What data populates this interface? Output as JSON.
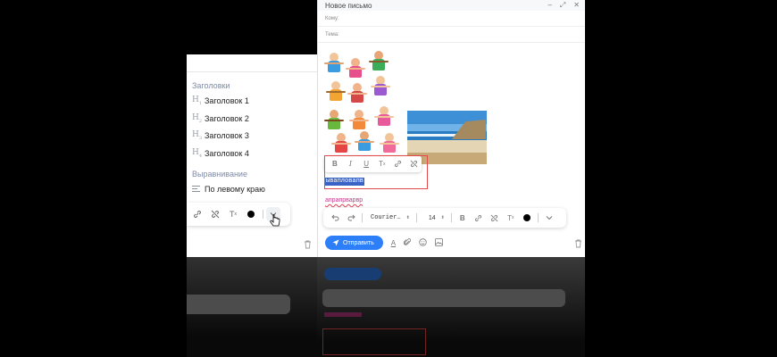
{
  "dropdown": {
    "headings_section": "Заголовки",
    "headings": [
      {
        "icon": "H",
        "level": "1",
        "label": "Заголовок 1"
      },
      {
        "icon": "H",
        "level": "2",
        "label": "Заголовок 2"
      },
      {
        "icon": "H",
        "level": "3",
        "label": "Заголовок 3"
      },
      {
        "icon": "H",
        "level": "4",
        "label": "Заголовок 4"
      }
    ],
    "align_section": "Выравнивание",
    "align_left": "По левому краю"
  },
  "compose": {
    "title": "Новое письмо",
    "to_label": "Кому:",
    "subject_label": "Тема:",
    "selected_text": "ывапловапв",
    "misspelled_text": "апрапрварвр",
    "font_name": "Courier…",
    "font_size": "14",
    "send_label": "Отправить"
  },
  "colors": {
    "accent": "#2d7ff9",
    "selection": "#3a63c8",
    "highlight_box": "#e24a4a",
    "spell_error": "#c2398a",
    "text_color": "#000000"
  }
}
